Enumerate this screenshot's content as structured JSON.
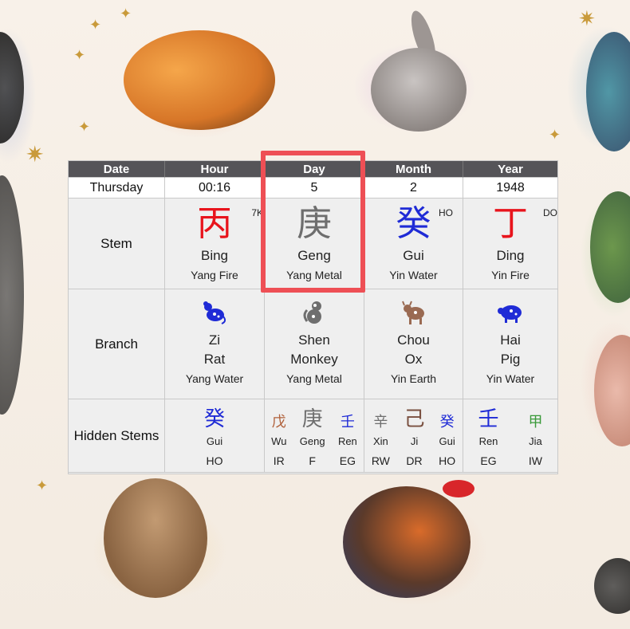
{
  "table": {
    "headers": [
      "Date",
      "Hour",
      "Day",
      "Month",
      "Year"
    ],
    "subheader": [
      "Thursday",
      "00:16",
      "5",
      "2",
      "1948"
    ],
    "row_labels": {
      "stem": "Stem",
      "branch": "Branch",
      "hidden": "Hidden Stems"
    },
    "stems": [
      {
        "char": "丙",
        "pinyin": "Bing",
        "element": "Yang Fire",
        "tag": "7K",
        "color": "#e8141c"
      },
      {
        "char": "庚",
        "pinyin": "Geng",
        "element": "Yang Metal",
        "tag": "",
        "color": "#6e6e6e"
      },
      {
        "char": "癸",
        "pinyin": "Gui",
        "element": "Yin Water",
        "tag": "HO",
        "color": "#1f2bd6"
      },
      {
        "char": "丁",
        "pinyin": "Ding",
        "element": "Yin Fire",
        "tag": "DO",
        "color": "#e8141c"
      }
    ],
    "branches": [
      {
        "icon": "rat-icon",
        "name": "Zi",
        "animal": "Rat",
        "element": "Yang Water",
        "color": "#1f2bd6"
      },
      {
        "icon": "monkey-icon",
        "name": "Shen",
        "animal": "Monkey",
        "element": "Yang Metal",
        "color": "#6e6e6e"
      },
      {
        "icon": "ox-icon",
        "name": "Chou",
        "animal": "Ox",
        "element": "Yin Earth",
        "color": "#9a6a52"
      },
      {
        "icon": "pig-icon",
        "name": "Hai",
        "animal": "Pig",
        "element": "Yin Water",
        "color": "#1f2bd6"
      }
    ],
    "hidden": [
      [
        {
          "char": "癸",
          "name": "Gui",
          "god": "HO",
          "color": "#1f2bd6",
          "size": "big"
        }
      ],
      [
        {
          "char": "戊",
          "name": "Wu",
          "god": "IR",
          "color": "#b0603a",
          "size": "small"
        },
        {
          "char": "庚",
          "name": "Geng",
          "god": "F",
          "color": "#6e6e6e",
          "size": "big"
        },
        {
          "char": "壬",
          "name": "Ren",
          "god": "EG",
          "color": "#1f2bd6",
          "size": "small"
        }
      ],
      [
        {
          "char": "辛",
          "name": "Xin",
          "god": "RW",
          "color": "#6e6e6e",
          "size": "small"
        },
        {
          "char": "己",
          "name": "Ji",
          "god": "DR",
          "color": "#7a5040",
          "size": "big"
        },
        {
          "char": "癸",
          "name": "Gui",
          "god": "HO",
          "color": "#1f2bd6",
          "size": "small"
        }
      ],
      [
        {
          "char": "壬",
          "name": "Ren",
          "god": "EG",
          "color": "#1f2bd6",
          "size": "big"
        },
        {
          "char": "甲",
          "name": "Jia",
          "god": "IW",
          "color": "#3a9a3a",
          "size": "small"
        }
      ]
    ]
  },
  "highlight_color": "#ee4f55"
}
